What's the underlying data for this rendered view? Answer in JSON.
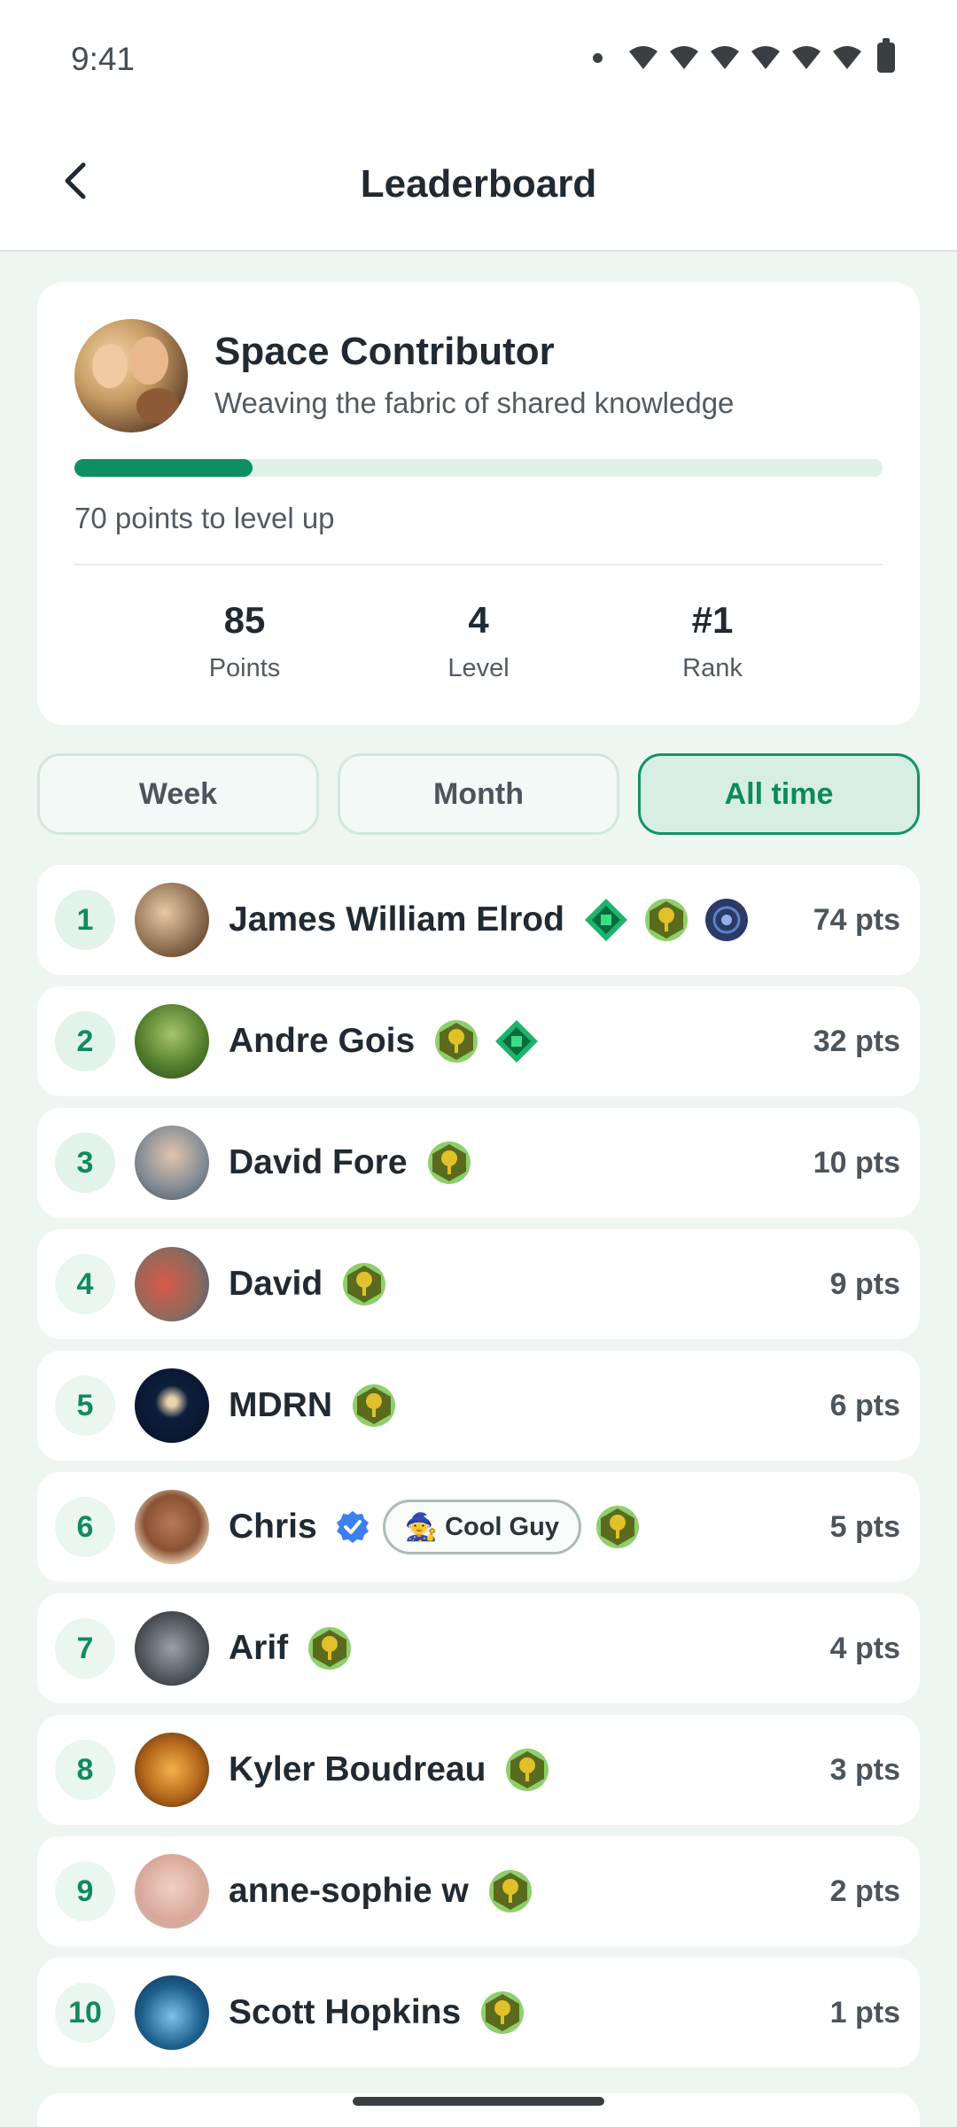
{
  "status_bar": {
    "time": "9:41"
  },
  "header": {
    "title": "Leaderboard"
  },
  "profile": {
    "name": "Space Contributor",
    "tagline": "Weaving the fabric of shared knowledge",
    "progress_fraction": 0.22,
    "levelup_text": "70 points to level up",
    "stats": [
      {
        "value": "85",
        "label": "Points"
      },
      {
        "value": "4",
        "label": "Level"
      },
      {
        "value": "#1",
        "label": "Rank"
      }
    ]
  },
  "tabs": [
    {
      "label": "Week",
      "active": false
    },
    {
      "label": "Month",
      "active": false
    },
    {
      "label": "All time",
      "active": true
    }
  ],
  "colors": {
    "accent": "#0e8f63",
    "background": "#eef6f2",
    "tab_active_bg": "#d7eee4"
  },
  "leaderboard": [
    {
      "rank": "1",
      "name": "James William Elrod",
      "points": "74 pts",
      "badges": [
        "green-gem-badge-icon",
        "gold-tree-badge-icon",
        "navy-orbit-badge-icon"
      ]
    },
    {
      "rank": "2",
      "name": "Andre Gois",
      "points": "32 pts",
      "badges": [
        "gold-tree-badge-icon",
        "green-gem-badge-icon"
      ]
    },
    {
      "rank": "3",
      "name": "David Fore",
      "points": "10 pts",
      "badges": [
        "gold-tree-badge-icon"
      ]
    },
    {
      "rank": "4",
      "name": "David",
      "points": "9 pts",
      "badges": [
        "gold-tree-badge-icon"
      ]
    },
    {
      "rank": "5",
      "name": "MDRN",
      "points": "6 pts",
      "badges": [
        "gold-tree-badge-icon"
      ]
    },
    {
      "rank": "6",
      "name": "Chris",
      "points": "5 pts",
      "verified": true,
      "tag": {
        "emoji": "🧙",
        "label": "Cool Guy"
      },
      "badges": [
        "gold-tree-badge-icon"
      ]
    },
    {
      "rank": "7",
      "name": "Arif",
      "points": "4 pts",
      "badges": [
        "gold-tree-badge-icon"
      ]
    },
    {
      "rank": "8",
      "name": "Kyler Boudreau",
      "points": "3 pts",
      "badges": [
        "gold-tree-badge-icon"
      ]
    },
    {
      "rank": "9",
      "name": "anne-sophie w",
      "points": "2 pts",
      "badges": [
        "gold-tree-badge-icon"
      ]
    },
    {
      "rank": "10",
      "name": "Scott Hopkins",
      "points": "1 pts",
      "badges": [
        "gold-tree-badge-icon"
      ]
    }
  ]
}
